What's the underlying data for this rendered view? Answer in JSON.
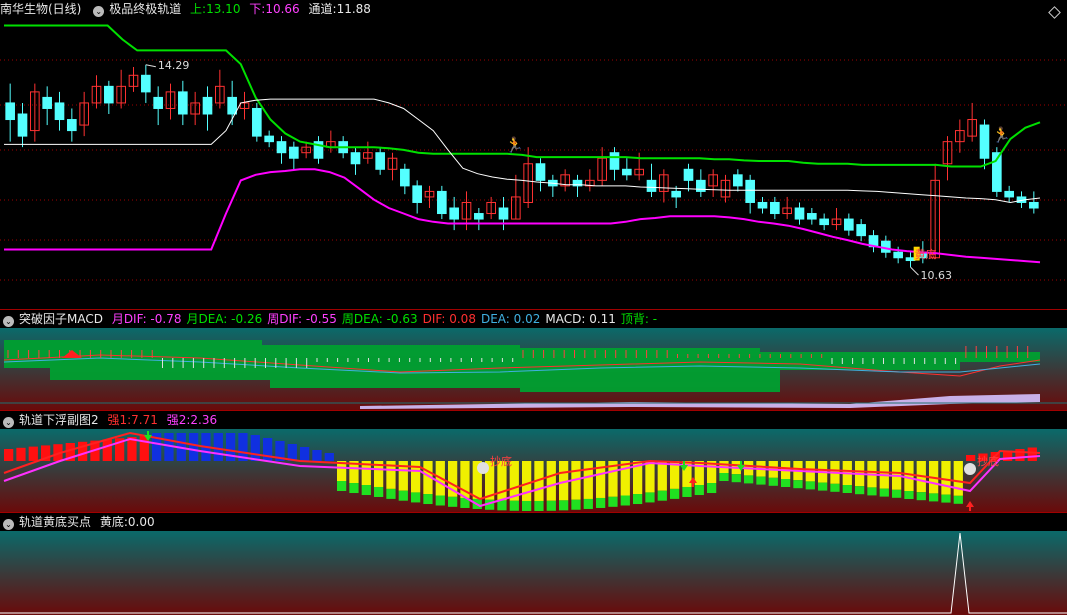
{
  "panel1": {
    "stock": "南华生物(日线)",
    "indicator": "极品终极轨道",
    "up_label": "上:",
    "up_value": "13.10",
    "down_label": "下:",
    "down_value": "10.66",
    "mid_label": "通道:",
    "mid_value": "11.88",
    "high_label": "14.29",
    "low_label": "10.63",
    "bottom_label": "黄底"
  },
  "panel2": {
    "title": "突破因子MACD",
    "items": [
      {
        "label": "月DIF:",
        "value": "-0.78",
        "color": "#ff40ff"
      },
      {
        "label": "月DEA:",
        "value": "-0.26",
        "color": "#00e000"
      },
      {
        "label": "周DIF:",
        "value": "-0.55",
        "color": "#ff40ff"
      },
      {
        "label": "周DEA:",
        "value": "-0.63",
        "color": "#00e000"
      },
      {
        "label": "DIF:",
        "value": "0.08",
        "color": "#ff3030"
      },
      {
        "label": "DEA:",
        "value": "0.02",
        "color": "#40b0e0"
      },
      {
        "label": "MACD:",
        "value": "0.11",
        "color": "#e8e8e8"
      },
      {
        "label": "顶背:",
        "value": "-",
        "color": "#00e000"
      }
    ]
  },
  "panel3": {
    "title": "轨道下浮副图2",
    "s1_label": "强1:",
    "s1_value": "7.71",
    "s2_label": "强2:",
    "s2_value": "2.36",
    "marker1": "抄底",
    "marker2": "抄底"
  },
  "panel4": {
    "title": "轨道黄底买点",
    "label": "黄底:",
    "value": "0.00"
  },
  "colors": {
    "up_candle": "#ff3232",
    "down_candle": "#54ffff",
    "upper_band": "#00e000",
    "lower_band": "#ff00ff",
    "mid_band": "#ffffff",
    "grid": "#a00000"
  },
  "chart_data": [
    {
      "type": "candlestick",
      "ylim": [
        10.0,
        15.1
      ],
      "high_marker": 14.29,
      "low_marker": 10.63,
      "series": [
        {
          "name": "上",
          "values": [
            15.0,
            15.0,
            15.0,
            15.0,
            15.0,
            15.0,
            15.0,
            15.0,
            14.75,
            14.55,
            14.55,
            14.55,
            14.55,
            14.55,
            14.55,
            14.55,
            14.3,
            13.7,
            13.3,
            13.05,
            12.9,
            12.85,
            12.8,
            12.8,
            12.8,
            12.8,
            12.78,
            12.75,
            12.7,
            12.68,
            12.68,
            12.68,
            12.68,
            12.68,
            12.68,
            12.66,
            12.62,
            12.62,
            12.62,
            12.62,
            12.62,
            12.62,
            12.62,
            12.6,
            12.6,
            12.6,
            12.6,
            12.6,
            12.58,
            12.58,
            12.56,
            12.55,
            12.55,
            12.55,
            12.52,
            12.5,
            12.5,
            12.5,
            12.48,
            12.48,
            12.48,
            12.48,
            12.48,
            12.48,
            12.45,
            12.45,
            12.45,
            12.55,
            12.95,
            13.15,
            13.25
          ]
        },
        {
          "name": "通道",
          "values": [
            12.85,
            12.85,
            12.85,
            12.85,
            12.85,
            12.85,
            12.85,
            12.85,
            12.85,
            12.85,
            12.85,
            12.85,
            12.85,
            12.85,
            12.85,
            13.1,
            13.6,
            13.65,
            13.67,
            13.67,
            13.67,
            13.67,
            13.67,
            13.67,
            13.67,
            13.67,
            13.6,
            13.5,
            13.3,
            13.1,
            12.75,
            12.42,
            12.32,
            12.26,
            12.22,
            12.2,
            12.17,
            12.15,
            12.12,
            12.12,
            12.1,
            12.1,
            12.1,
            12.08,
            12.07,
            12.06,
            12.05,
            12.04,
            12.03,
            12.02,
            12.02,
            12.02,
            12.02,
            12.02,
            12.02,
            12.02,
            12.02,
            12.02,
            12.01,
            12.0,
            11.98,
            11.96,
            11.94,
            11.92,
            11.9,
            11.88,
            11.87,
            11.85,
            11.8,
            11.85,
            11.88
          ]
        },
        {
          "name": "下",
          "values": [
            10.95,
            10.95,
            10.95,
            10.95,
            10.95,
            10.95,
            10.95,
            10.95,
            10.95,
            10.95,
            10.95,
            10.95,
            10.95,
            10.95,
            10.95,
            11.6,
            12.2,
            12.3,
            12.35,
            12.37,
            12.4,
            12.4,
            12.35,
            12.25,
            12.05,
            11.85,
            11.7,
            11.6,
            11.5,
            11.45,
            11.42,
            11.42,
            11.42,
            11.42,
            11.42,
            11.42,
            11.42,
            11.42,
            11.42,
            11.42,
            11.42,
            11.42,
            11.45,
            11.5,
            11.52,
            11.55,
            11.55,
            11.55,
            11.55,
            11.53,
            11.5,
            11.45,
            11.42,
            11.38,
            11.32,
            11.25,
            11.18,
            11.12,
            11.05,
            11.0,
            10.95,
            10.92,
            10.9,
            10.88,
            10.85,
            10.82,
            10.8,
            10.78,
            10.76,
            10.74,
            10.72
          ]
        }
      ],
      "candles": [
        [
          13.6,
          13.3,
          13.95,
          12.9
        ],
        [
          13.4,
          13.0,
          13.6,
          12.8
        ],
        [
          13.1,
          13.8,
          13.95,
          12.9
        ],
        [
          13.7,
          13.5,
          13.9,
          13.2
        ],
        [
          13.6,
          13.3,
          13.8,
          13.1
        ],
        [
          13.3,
          13.1,
          13.5,
          12.9
        ],
        [
          13.2,
          13.6,
          13.8,
          13.0
        ],
        [
          13.6,
          13.9,
          14.1,
          13.5
        ],
        [
          13.9,
          13.6,
          14.0,
          13.4
        ],
        [
          13.6,
          13.9,
          14.2,
          13.5
        ],
        [
          13.9,
          14.1,
          14.25,
          13.8
        ],
        [
          14.1,
          13.8,
          14.29,
          13.6
        ],
        [
          13.7,
          13.5,
          13.9,
          13.2
        ],
        [
          13.5,
          13.8,
          13.95,
          13.3
        ],
        [
          13.8,
          13.4,
          14.0,
          13.2
        ],
        [
          13.4,
          13.6,
          13.8,
          13.2
        ],
        [
          13.7,
          13.4,
          13.9,
          13.1
        ],
        [
          13.6,
          13.9,
          14.2,
          13.5
        ],
        [
          13.7,
          13.4,
          14.0,
          13.2
        ],
        [
          13.5,
          13.6,
          13.8,
          13.3
        ],
        [
          13.5,
          13.0,
          13.6,
          12.9
        ],
        [
          13.0,
          12.9,
          13.1,
          12.8
        ],
        [
          12.9,
          12.7,
          13.0,
          12.5
        ],
        [
          12.8,
          12.6,
          12.9,
          12.4
        ],
        [
          12.7,
          12.8,
          12.9,
          12.6
        ],
        [
          12.9,
          12.6,
          13.0,
          12.5
        ],
        [
          12.8,
          12.9,
          13.1,
          12.7
        ],
        [
          12.9,
          12.7,
          13.0,
          12.6
        ],
        [
          12.7,
          12.5,
          12.8,
          12.3
        ],
        [
          12.6,
          12.7,
          12.9,
          12.5
        ],
        [
          12.7,
          12.4,
          12.8,
          12.3
        ],
        [
          12.4,
          12.6,
          12.7,
          12.2
        ],
        [
          12.4,
          12.1,
          12.5,
          11.95
        ],
        [
          12.1,
          11.8,
          12.2,
          11.6
        ],
        [
          11.9,
          12.0,
          12.1,
          11.7
        ],
        [
          12.0,
          11.6,
          12.1,
          11.5
        ],
        [
          11.7,
          11.5,
          11.9,
          11.3
        ],
        [
          11.5,
          11.8,
          12.0,
          11.3
        ],
        [
          11.6,
          11.5,
          11.7,
          11.3
        ],
        [
          11.6,
          11.8,
          11.9,
          11.5
        ],
        [
          11.7,
          11.5,
          11.9,
          11.3
        ],
        [
          11.5,
          11.9,
          12.3,
          11.5
        ],
        [
          11.8,
          12.5,
          12.8,
          11.7
        ],
        [
          12.5,
          12.2,
          12.6,
          12.0
        ],
        [
          12.2,
          12.1,
          12.3,
          11.9
        ],
        [
          12.1,
          12.3,
          12.4,
          12.0
        ],
        [
          12.2,
          12.1,
          12.3,
          11.9
        ],
        [
          12.1,
          12.2,
          12.4,
          12.0
        ],
        [
          12.2,
          12.6,
          12.8,
          12.1
        ],
        [
          12.7,
          12.4,
          12.8,
          12.2
        ],
        [
          12.4,
          12.3,
          12.6,
          12.2
        ],
        [
          12.3,
          12.4,
          12.7,
          12.2
        ],
        [
          12.2,
          12.0,
          12.5,
          11.9
        ],
        [
          12.0,
          12.3,
          12.4,
          11.8
        ],
        [
          12.0,
          11.9,
          12.1,
          11.7
        ],
        [
          12.4,
          12.2,
          12.5,
          12.0
        ],
        [
          12.2,
          12.0,
          12.4,
          11.9
        ],
        [
          12.1,
          12.3,
          12.4,
          11.9
        ],
        [
          11.9,
          12.2,
          12.3,
          11.8
        ],
        [
          12.3,
          12.1,
          12.4,
          12.0
        ],
        [
          12.2,
          11.8,
          12.3,
          11.6
        ],
        [
          11.8,
          11.7,
          11.9,
          11.6
        ],
        [
          11.8,
          11.6,
          11.9,
          11.5
        ],
        [
          11.6,
          11.7,
          11.9,
          11.5
        ],
        [
          11.7,
          11.5,
          11.8,
          11.4
        ],
        [
          11.6,
          11.5,
          11.7,
          11.4
        ],
        [
          11.5,
          11.4,
          11.6,
          11.3
        ],
        [
          11.4,
          11.5,
          11.7,
          11.3
        ],
        [
          11.5,
          11.3,
          11.6,
          11.2
        ],
        [
          11.4,
          11.2,
          11.5,
          11.1
        ],
        [
          11.2,
          11.0,
          11.3,
          10.9
        ],
        [
          11.1,
          10.9,
          11.2,
          10.8
        ],
        [
          10.9,
          10.8,
          11.0,
          10.7
        ],
        [
          10.8,
          10.75,
          10.9,
          10.63
        ],
        [
          10.9,
          10.8,
          11.1,
          10.7
        ],
        [
          10.8,
          12.2,
          12.5,
          10.8
        ],
        [
          12.5,
          12.9,
          13.0,
          12.2
        ],
        [
          12.9,
          13.1,
          13.3,
          12.7
        ],
        [
          13.0,
          13.3,
          13.6,
          12.9
        ],
        [
          13.2,
          12.6,
          13.3,
          12.4
        ],
        [
          12.7,
          12.0,
          12.8,
          11.9
        ],
        [
          12.0,
          11.9,
          12.1,
          11.8
        ],
        [
          11.9,
          11.8,
          12.0,
          11.7
        ],
        [
          11.8,
          11.7,
          12.0,
          11.6
        ]
      ]
    },
    {
      "type": "bar",
      "title": "突破因子MACD"
    },
    {
      "type": "bar",
      "title": "轨道下浮副图2"
    },
    {
      "type": "line",
      "title": "轨道黄底买点",
      "values_note_peak_index": 0,
      "ylim": [
        0,
        1
      ]
    }
  ]
}
